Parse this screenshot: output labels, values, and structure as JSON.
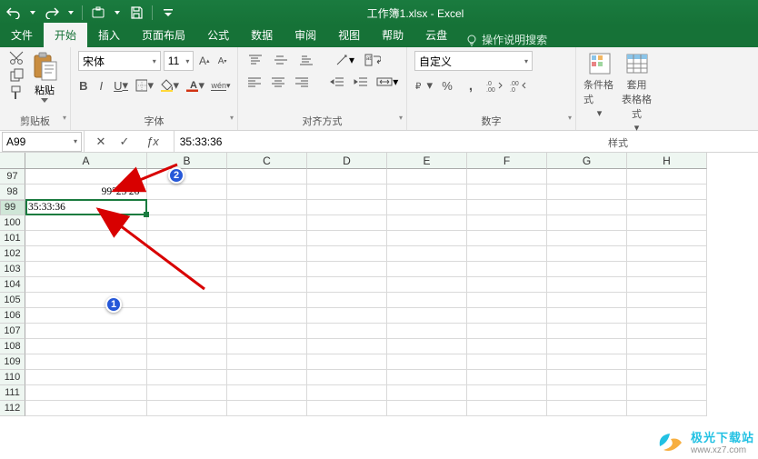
{
  "title": "工作簿1.xlsx  -  Excel",
  "tabs": {
    "file": "文件",
    "home": "开始",
    "insert": "插入",
    "layout": "页面布局",
    "formulas": "公式",
    "data": "数据",
    "review": "审阅",
    "view": "视图",
    "help": "帮助",
    "cloud": "云盘",
    "tellme": "操作说明搜索"
  },
  "ribbon": {
    "clipboard": {
      "paste": "粘贴",
      "label": "剪贴板"
    },
    "font": {
      "name": "宋体",
      "size": "11",
      "label": "字体",
      "bold": "B",
      "italic": "I",
      "underline": "U"
    },
    "align": {
      "label": "对齐方式"
    },
    "number": {
      "format": "自定义",
      "label": "数字"
    },
    "styles": {
      "cond": "条件格式",
      "table": "套用\n表格格式",
      "label": "样式"
    }
  },
  "nameBox": "A99",
  "formulaBar": "35:33:36",
  "columns": [
    "A",
    "B",
    "C",
    "D",
    "E",
    "F",
    "G",
    "H"
  ],
  "rowStart": 97,
  "rowEnd": 112,
  "activeRow": 99,
  "cells": {
    "A98": "99°25′26″",
    "A99": "35:33:36"
  },
  "annotations": {
    "badge1": "1",
    "badge2": "2"
  },
  "watermark": {
    "name": "极光下载站",
    "url": "www.xz7.com"
  }
}
